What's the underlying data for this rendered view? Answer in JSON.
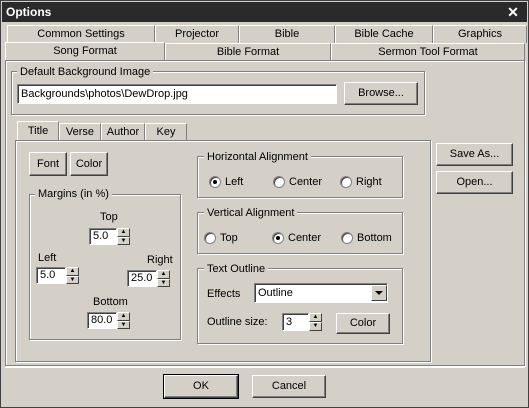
{
  "window": {
    "title": "Options",
    "close_glyph": "✕"
  },
  "tabs_row1": [
    "Common Settings",
    "Projector Window",
    "Bible",
    "Bible Cache",
    "Graphics"
  ],
  "tabs_row2": [
    "Song Format",
    "Bible Format",
    "Sermon Tool Format"
  ],
  "background": {
    "label": "Default Background Image",
    "path": "Backgrounds\\photos\\DewDrop.jpg",
    "browse": "Browse..."
  },
  "subtabs": [
    "Title",
    "Verse",
    "Author",
    "Key"
  ],
  "font_button": "Font",
  "color_button": "Color",
  "margins": {
    "label": "Margins (in %)",
    "top_label": "Top",
    "top": "5.0",
    "left_label": "Left",
    "left": "5.0",
    "right_label": "Right",
    "right": "25.0",
    "bottom_label": "Bottom",
    "bottom": "80.0"
  },
  "horizontal": {
    "label": "Horizontal Alignment",
    "left": "Left",
    "center": "Center",
    "right": "Right",
    "selected": "left"
  },
  "vertical": {
    "label": "Vertical Alignment",
    "top": "Top",
    "center": "Center",
    "bottom": "Bottom",
    "selected": "center"
  },
  "outline": {
    "label": "Text Outline",
    "effects_label": "Effects",
    "effects": "Outline",
    "size_label": "Outline size:",
    "size": "3",
    "color_button": "Color"
  },
  "side": {
    "save_as": "Save As...",
    "open": "Open..."
  },
  "footer": {
    "ok": "OK",
    "cancel": "Cancel"
  }
}
